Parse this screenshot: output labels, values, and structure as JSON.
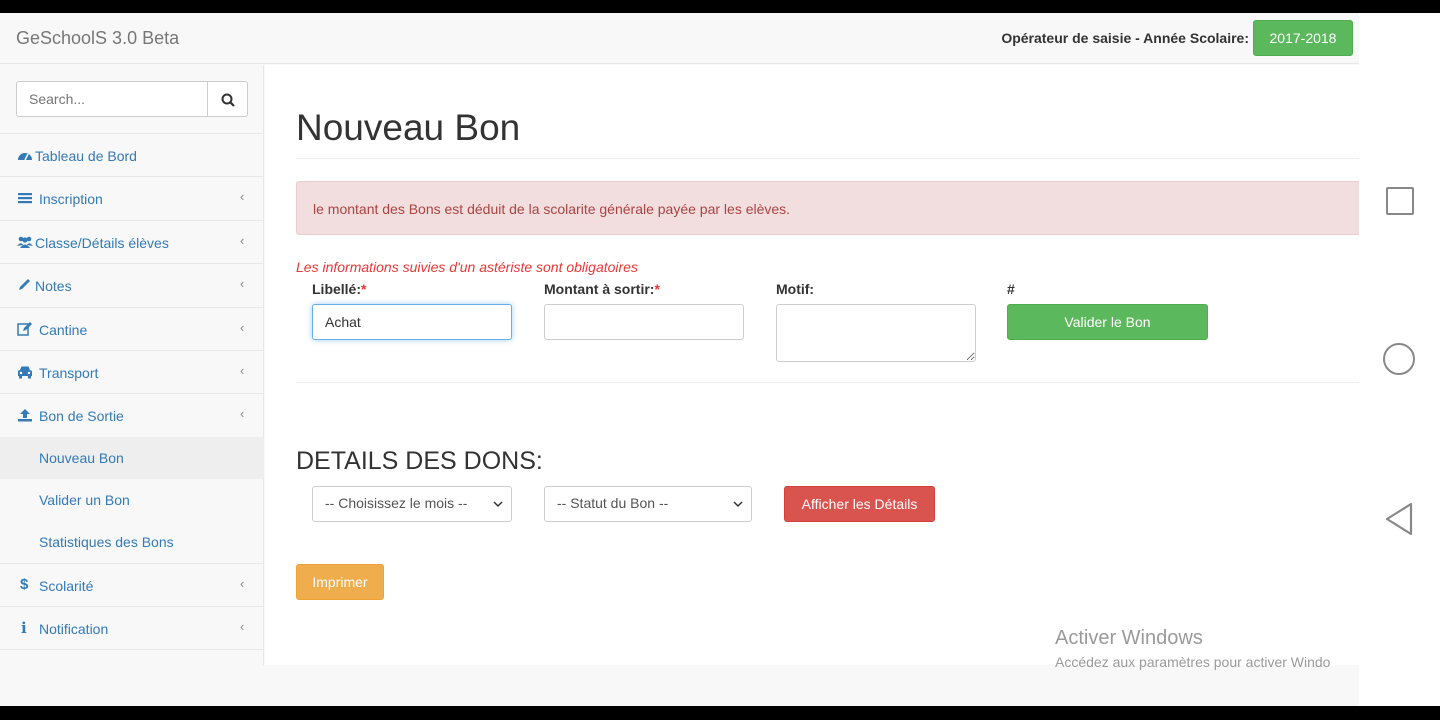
{
  "navbar": {
    "brand": "GeSchoolS 3.0 Beta",
    "operator_text": "Opérateur de saisie - Année Scolaire:",
    "school_year": "2017-2018"
  },
  "sidebar": {
    "search_placeholder": "Search...",
    "items": [
      {
        "label": "Tableau de Bord",
        "icon": "dashboard-icon"
      },
      {
        "label": "Inscription",
        "icon": "list-icon"
      },
      {
        "label": "Classe/Détails élèves",
        "icon": "users-icon"
      },
      {
        "label": "Notes",
        "icon": "pencil-icon"
      },
      {
        "label": "Cantine",
        "icon": "edit-icon"
      },
      {
        "label": "Transport",
        "icon": "car-icon"
      },
      {
        "label": "Bon de Sortie",
        "icon": "upload-icon"
      }
    ],
    "subitems": [
      {
        "label": "Nouveau Bon",
        "active": true
      },
      {
        "label": "Valider un Bon"
      },
      {
        "label": "Statistiques des Bons"
      }
    ],
    "items_after": [
      {
        "label": "Scolarité",
        "icon": "dollar-icon"
      },
      {
        "label": "Notification",
        "icon": "info-icon"
      }
    ]
  },
  "main": {
    "title": "Nouveau Bon",
    "alert": "le montant des Bons est déduit de la scolarite générale payée par les elèves.",
    "required_note": "Les informations suivies d'un astériste sont obligatoires",
    "form": {
      "libelle_label": "Libellé:",
      "libelle_value": "Achat",
      "montant_label": "Montant à sortir:",
      "montant_value": "",
      "motif_label": "Motif:",
      "hash_label": "#",
      "required_mark": "*",
      "submit_label": "Valider le Bon"
    },
    "details": {
      "title": "DETAILS DES DONS:",
      "month_select": "-- Choisissez le mois --",
      "status_select": "-- Statut du Bon --",
      "show_button": "Afficher les Détails"
    },
    "print_button": "Imprimer"
  },
  "watermark": {
    "line1": "Activer Windows",
    "line2": "Accédez aux paramètres pour activer Windo"
  },
  "colors": {
    "success": "#5cb85c",
    "danger": "#d9534f",
    "warning": "#f0ad4e",
    "link": "#337ab7",
    "alert_bg": "#f2dede"
  }
}
